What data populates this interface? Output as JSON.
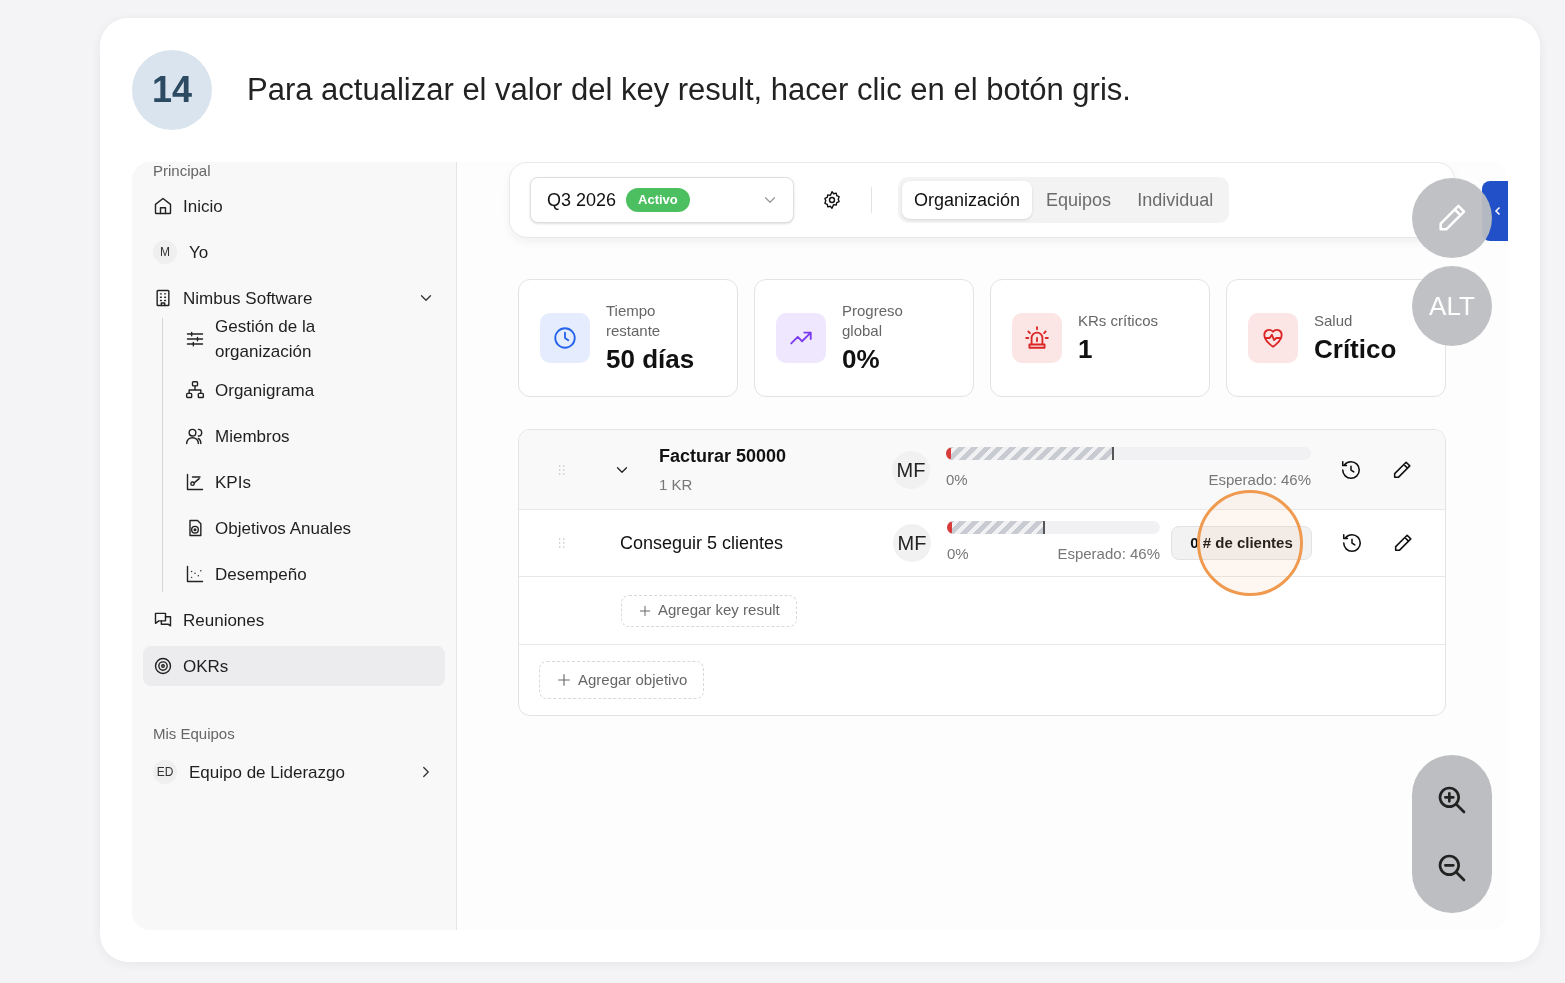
{
  "step": {
    "number": "14",
    "instruction": "Para actualizar el valor del key result, hacer clic en el botón gris."
  },
  "sidebar": {
    "sections": [
      {
        "title": "Principal",
        "items": [
          {
            "kind": "home",
            "label": "Inicio",
            "selected": false
          },
          {
            "kind": "avatar",
            "initials": "M",
            "label": "Yo",
            "selected": false
          },
          {
            "kind": "building",
            "label": "Nimbus Software",
            "selected": false,
            "expanded": true,
            "children": [
              {
                "kind": "sliders",
                "label": "Gestión de la organización",
                "selected": false
              },
              {
                "kind": "org",
                "label": "Organigrama",
                "selected": false
              },
              {
                "kind": "users",
                "label": "Miembros",
                "selected": false
              },
              {
                "kind": "kpi",
                "label": "KPIs",
                "selected": false
              },
              {
                "kind": "goal",
                "label": "Objetivos Anuales",
                "selected": false
              },
              {
                "kind": "scatter",
                "label": "Desempeño",
                "selected": false
              }
            ]
          },
          {
            "kind": "chat",
            "label": "Reuniones",
            "selected": false
          },
          {
            "kind": "target",
            "label": "OKRs",
            "selected": true
          }
        ]
      },
      {
        "title": "Mis Equipos",
        "items": [
          {
            "kind": "avatar",
            "initials": "ED",
            "label": "Equipo de Liderazgo",
            "selected": false,
            "expanded": false
          }
        ]
      }
    ]
  },
  "toolbar": {
    "period": {
      "value": "Q3 2026",
      "badge": "Activo"
    },
    "tabs": [
      {
        "label": "Organización",
        "selected": true
      },
      {
        "label": "Equipos",
        "selected": false
      },
      {
        "label": "Individual",
        "selected": false
      }
    ]
  },
  "stats": [
    {
      "kind": "clock",
      "color": "#2563eb",
      "label": "Tiempo restante",
      "value": "50 días"
    },
    {
      "kind": "trend",
      "color": "#7c3aed",
      "label": "Progreso global",
      "value": "0%"
    },
    {
      "kind": "alarm",
      "color": "#dc2626",
      "label": "KRs críticos",
      "value": "1"
    },
    {
      "kind": "heart",
      "color": "#dc2626",
      "label": "Salud",
      "value": "Crítico"
    }
  ],
  "objectives": [
    {
      "title": "Facturar 50000",
      "subtitle": "1 KR",
      "expanded": true,
      "owner": "MF",
      "progress": {
        "level": 0,
        "label": "0%",
        "expected": {
          "level": 0.46,
          "label": "Esperado: 46%"
        }
      },
      "key_results": [
        {
          "title": "Conseguir 5 clientes",
          "owner": "MF",
          "progress": {
            "level": 0,
            "label": "0%",
            "expected": {
              "level": 0.46,
              "label": "Esperado: 46%"
            }
          },
          "value_button": {
            "label": "0 # de clientes",
            "highlighted": true
          }
        }
      ],
      "add_key_result": "Agregar key result"
    }
  ],
  "add_objective": "Agregar objetivo",
  "floating_tools": {
    "alt_label": "ALT"
  }
}
